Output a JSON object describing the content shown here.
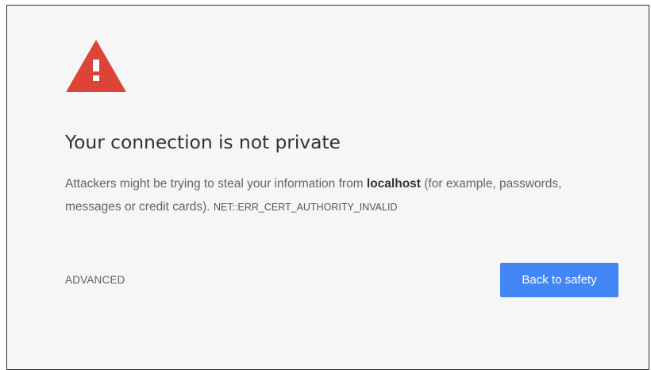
{
  "interstitial": {
    "icon": "warning-triangle-icon",
    "icon_color": "#db4437",
    "title": "Your connection is not private",
    "description": {
      "prefix": "Attackers might be trying to steal your information from ",
      "host": "localhost",
      "suffix": " (for example, passwords, messages or credit cards). ",
      "error_code": "NET::ERR_CERT_AUTHORITY_INVALID"
    },
    "advanced_label": "ADVANCED",
    "back_button_label": "Back to safety",
    "button_color": "#4285f4"
  }
}
